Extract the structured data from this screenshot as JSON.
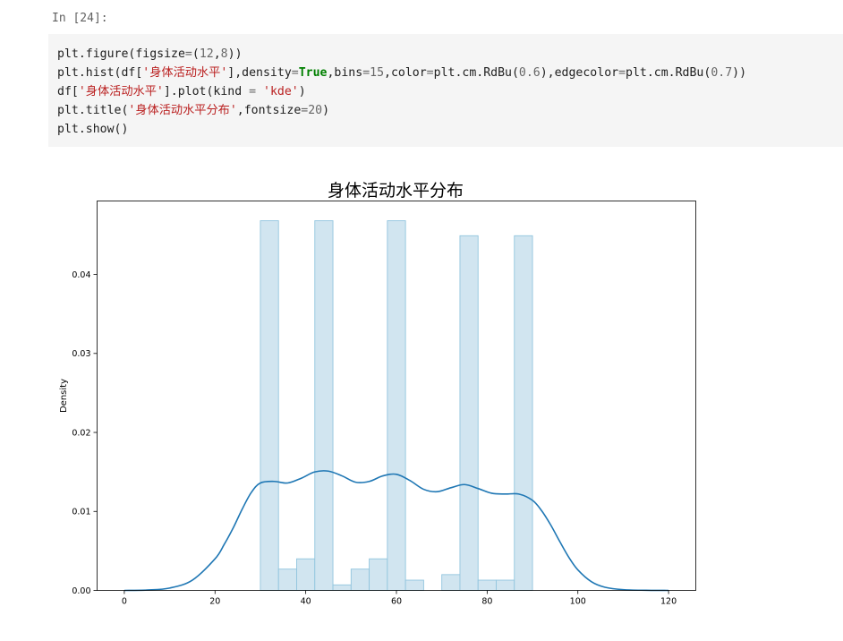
{
  "cell": {
    "prompt": "In [24]:",
    "code_lines": [
      [
        {
          "t": "plt.figure(figsize",
          "c": ""
        },
        {
          "t": "=",
          "c": "op"
        },
        {
          "t": "(",
          "c": ""
        },
        {
          "t": "12",
          "c": "num"
        },
        {
          "t": ",",
          "c": ""
        },
        {
          "t": "8",
          "c": "num"
        },
        {
          "t": "))",
          "c": ""
        }
      ],
      [
        {
          "t": "plt.hist(df[",
          "c": ""
        },
        {
          "t": "'身体活动水平'",
          "c": "str"
        },
        {
          "t": "],density",
          "c": ""
        },
        {
          "t": "=",
          "c": "op"
        },
        {
          "t": "True",
          "c": "kw"
        },
        {
          "t": ",bins",
          "c": ""
        },
        {
          "t": "=",
          "c": "op"
        },
        {
          "t": "15",
          "c": "num"
        },
        {
          "t": ",color",
          "c": ""
        },
        {
          "t": "=",
          "c": "op"
        },
        {
          "t": "plt.cm.RdBu(",
          "c": ""
        },
        {
          "t": "0.6",
          "c": "num"
        },
        {
          "t": "),edgecolor",
          "c": ""
        },
        {
          "t": "=",
          "c": "op"
        },
        {
          "t": "plt.cm.RdBu(",
          "c": ""
        },
        {
          "t": "0.7",
          "c": "num"
        },
        {
          "t": "))",
          "c": ""
        }
      ],
      [
        {
          "t": "df[",
          "c": ""
        },
        {
          "t": "'身体活动水平'",
          "c": "str"
        },
        {
          "t": "].plot(kind ",
          "c": ""
        },
        {
          "t": "=",
          "c": "op"
        },
        {
          "t": " ",
          "c": ""
        },
        {
          "t": "'kde'",
          "c": "str"
        },
        {
          "t": ")",
          "c": ""
        }
      ],
      [
        {
          "t": "plt.title(",
          "c": ""
        },
        {
          "t": "'身体活动水平分布'",
          "c": "str"
        },
        {
          "t": ",fontsize",
          "c": ""
        },
        {
          "t": "=",
          "c": "op"
        },
        {
          "t": "20",
          "c": "num"
        },
        {
          "t": ")",
          "c": ""
        }
      ],
      [
        {
          "t": "plt.show()",
          "c": ""
        }
      ]
    ]
  },
  "chart_data": {
    "type": "bar",
    "title": "身体活动水平分布",
    "xlabel": "",
    "ylabel": "Density",
    "xlim": [
      -6,
      126
    ],
    "ylim": [
      0,
      0.0493
    ],
    "xticks": [
      0,
      20,
      40,
      60,
      80,
      100,
      120
    ],
    "xtick_labels": [
      "0",
      "20",
      "40",
      "60",
      "80",
      "100",
      "120"
    ],
    "yticks": [
      0.0,
      0.01,
      0.02,
      0.03,
      0.04
    ],
    "ytick_labels": [
      "0.00",
      "0.01",
      "0.02",
      "0.03",
      "0.04"
    ],
    "grid": false,
    "bin_edges": [
      30,
      34,
      38,
      42,
      46,
      50,
      54,
      58,
      62,
      66,
      70,
      74,
      78,
      82,
      86,
      90
    ],
    "hist_values": [
      0.0468,
      0.0027,
      0.004,
      0.0468,
      0.0007,
      0.0027,
      0.004,
      0.0468,
      0.0013,
      0.0,
      0.002,
      0.0449,
      0.0013,
      0.0013,
      0.0449
    ],
    "bar_color": "#d1e5f0",
    "bar_edge_color": "#92c5de",
    "kde": {
      "color": "#1f77b4",
      "x": [
        0,
        5,
        10,
        15,
        20,
        22,
        24,
        26,
        28,
        30,
        33,
        36,
        39,
        42,
        45,
        48,
        51,
        54,
        57,
        60,
        63,
        66,
        69,
        72,
        75,
        78,
        81,
        84,
        87,
        90,
        92,
        94,
        96,
        98,
        100,
        103,
        106,
        110,
        115,
        120
      ],
      "y": [
        0.0,
        5e-05,
        0.0003,
        0.0013,
        0.004,
        0.0058,
        0.0079,
        0.0103,
        0.0124,
        0.0136,
        0.0138,
        0.0136,
        0.0142,
        0.015,
        0.0151,
        0.0145,
        0.0137,
        0.0138,
        0.0145,
        0.0147,
        0.0139,
        0.0128,
        0.0125,
        0.013,
        0.0134,
        0.0129,
        0.0123,
        0.0122,
        0.0122,
        0.0114,
        0.0101,
        0.0083,
        0.0062,
        0.0042,
        0.0026,
        0.0011,
        0.0004,
        0.0001,
        2e-05,
        0.0
      ]
    }
  }
}
